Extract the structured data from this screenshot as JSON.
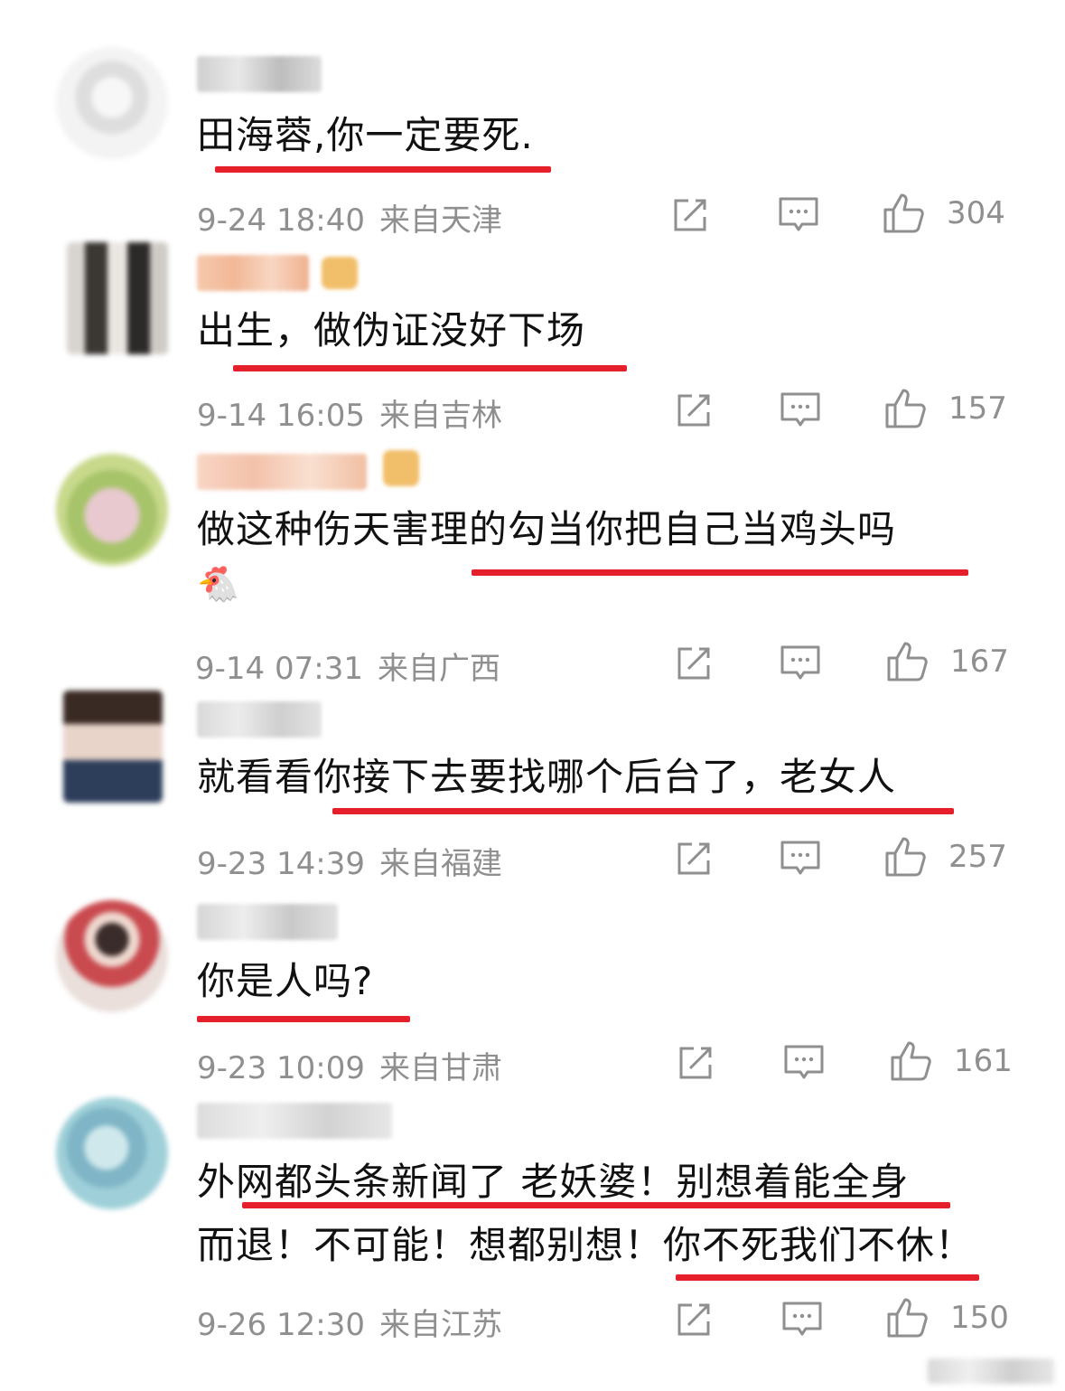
{
  "comments": [
    {
      "text": "田海蓉,你一定要死.",
      "time": "9-24 18:40",
      "location": "来自天津",
      "likes": "304"
    },
    {
      "text": "出生，做伪证没好下场",
      "time": "9-14 16:05",
      "location": "来自吉林",
      "likes": "157"
    },
    {
      "text": "做这种伤天害理的勾当你把自己当鸡头吗",
      "emoji": "🐔",
      "time": "9-14 07:31",
      "location": "来自广西",
      "likes": "167"
    },
    {
      "text": "就看看你接下去要找哪个后台了，老女人",
      "time": "9-23 14:39",
      "location": "来自福建",
      "likes": "257"
    },
    {
      "text": "你是人吗?",
      "time": "9-23 10:09",
      "location": "来自甘肃",
      "likes": "161"
    },
    {
      "text_line1": "外网都头条新闻了  老妖婆！别想着能全身",
      "text_line2": "而退！不可能！想都别想！你不死我们不休！",
      "time": "9-26 12:30",
      "location": "来自江苏",
      "likes": "150"
    }
  ],
  "icons": {
    "share": "share-icon",
    "comment": "comment-icon",
    "like": "thumbs-up-icon"
  },
  "colors": {
    "underline": "#e5202a",
    "meta": "#8f8f8f",
    "text": "#111111"
  }
}
